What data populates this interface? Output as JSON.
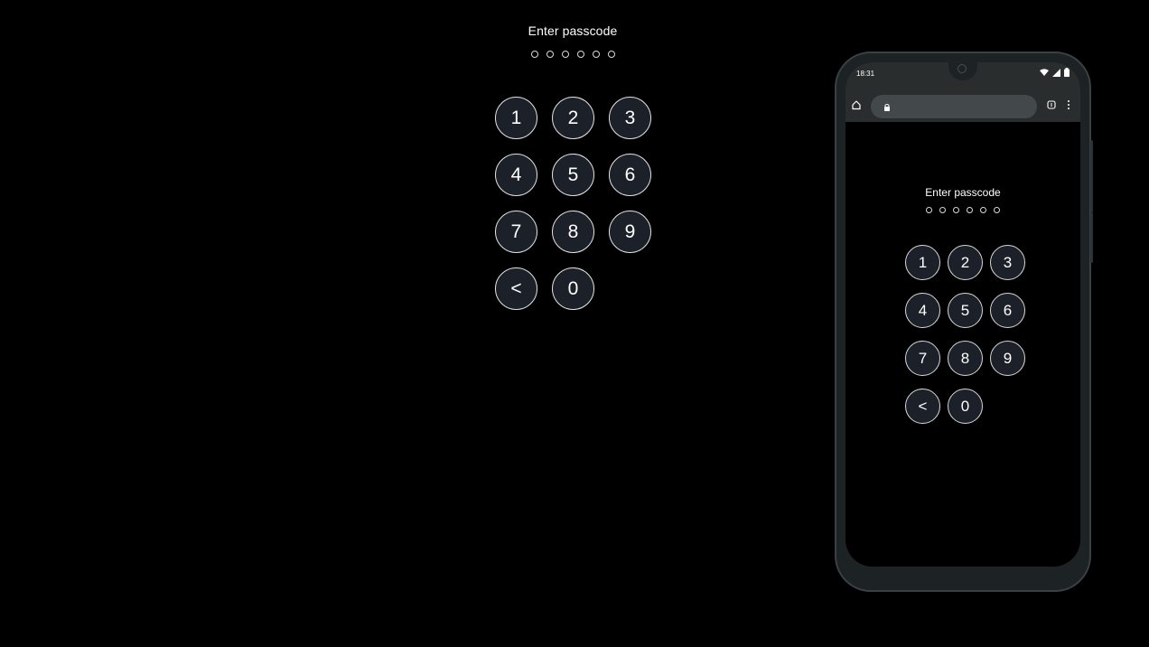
{
  "main": {
    "title": "Enter passcode",
    "dots_count": 6,
    "keys": [
      "1",
      "2",
      "3",
      "4",
      "5",
      "6",
      "7",
      "8",
      "9",
      "<",
      "0"
    ]
  },
  "phone": {
    "status_time": "18:31",
    "status_icons": [
      "wifi-icon",
      "signal-icon",
      "battery-icon"
    ],
    "browser": {
      "icons": [
        "home-icon",
        "lock-icon",
        "tabs-icon",
        "menu-icon"
      ]
    },
    "passcode": {
      "title": "Enter passcode",
      "dots_count": 6,
      "keys": [
        "1",
        "2",
        "3",
        "4",
        "5",
        "6",
        "7",
        "8",
        "9",
        "<",
        "0"
      ]
    }
  },
  "colors": {
    "background": "#000000",
    "key_fill": "#1c2029",
    "key_border": "#e4e4e4",
    "phone_frame": "#1d2224",
    "browser_bar": "#2a2d2e",
    "url_field": "#43484a"
  }
}
